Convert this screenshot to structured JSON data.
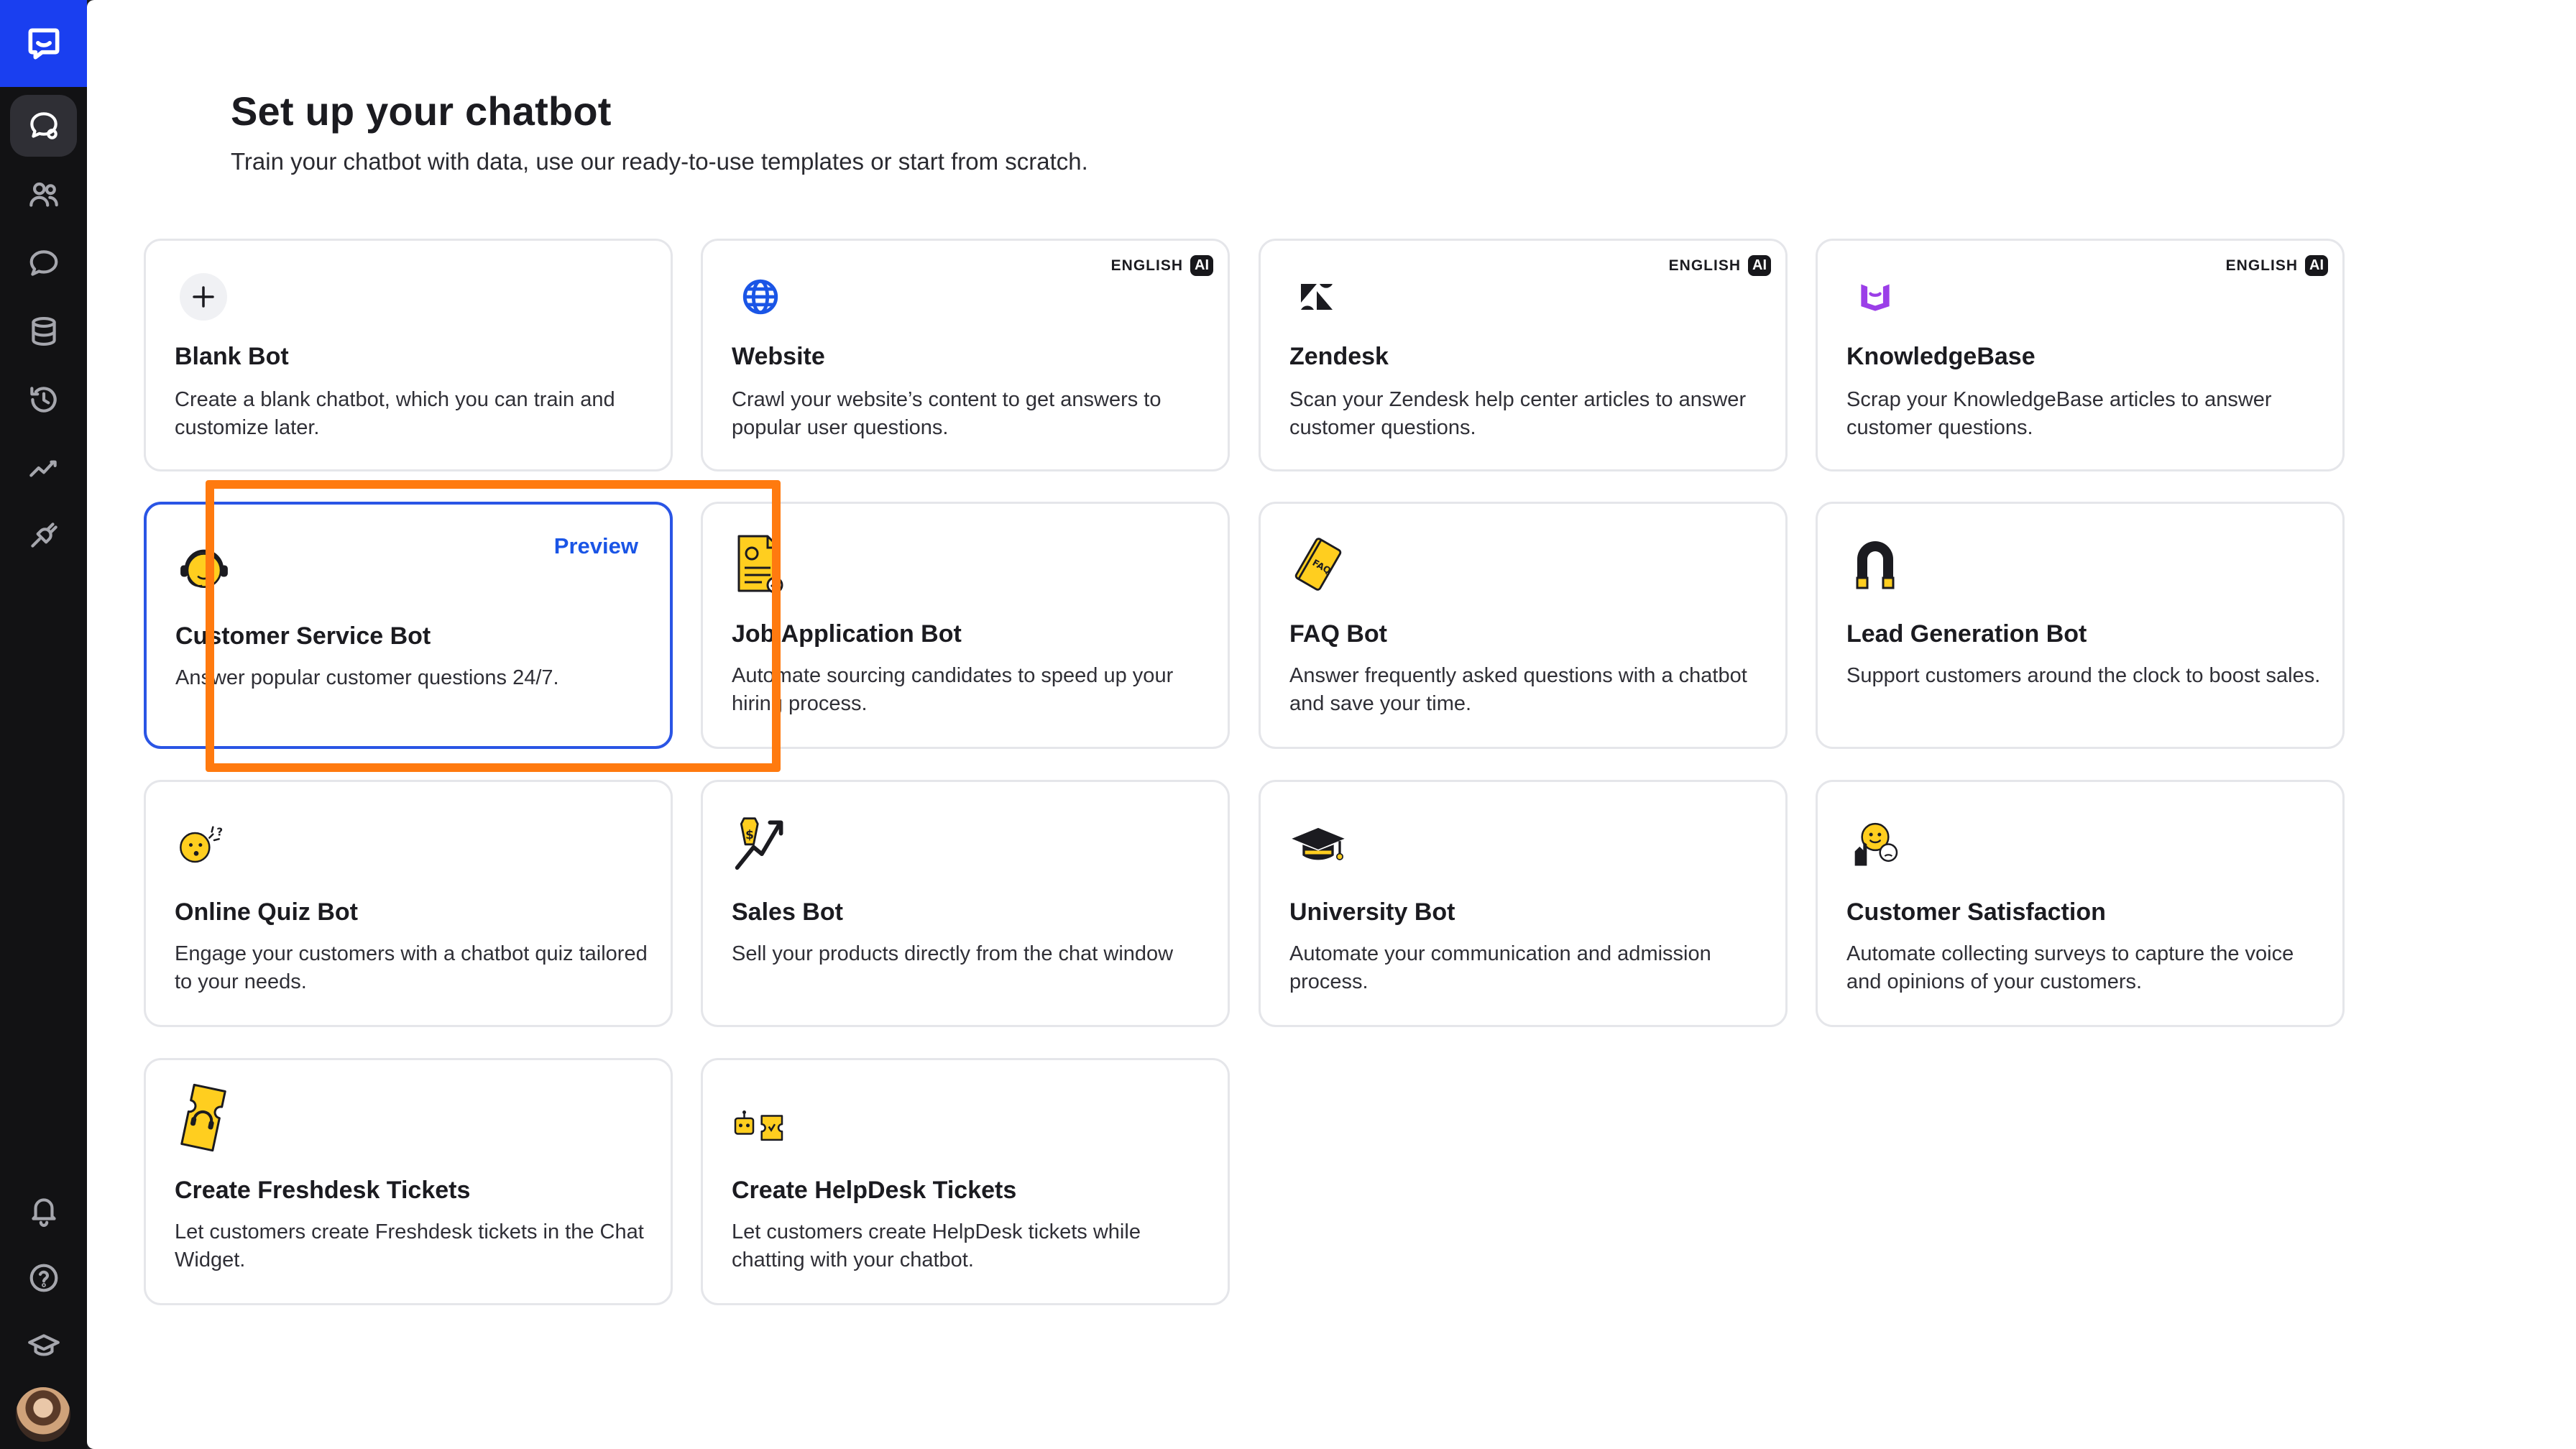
{
  "header": {
    "title": "Set up your chatbot",
    "subtitle": "Train your chatbot with data, use our ready-to-use templates or start from scratch."
  },
  "sidebar": {
    "items": [
      {
        "name": "chatbots",
        "icon": "chat-bot-icon",
        "active": true
      },
      {
        "name": "audience",
        "icon": "users-icon"
      },
      {
        "name": "chats",
        "icon": "chat-bubble-icon"
      },
      {
        "name": "data",
        "icon": "database-icon"
      },
      {
        "name": "history",
        "icon": "history-icon"
      },
      {
        "name": "reports",
        "icon": "chart-line-icon"
      },
      {
        "name": "integrations",
        "icon": "plug-icon"
      },
      {
        "name": "notifications",
        "icon": "bell-icon"
      },
      {
        "name": "help",
        "icon": "help-circle-icon"
      },
      {
        "name": "academy",
        "icon": "graduation-cap-icon"
      }
    ]
  },
  "badge": {
    "lang": "ENGLISH",
    "ai": "AI"
  },
  "cards": {
    "blank": {
      "title": "Blank Bot",
      "desc": "Create a blank chatbot, which you can train and customize later."
    },
    "website": {
      "title": "Website",
      "desc": "Crawl your website’s content to get answers to popular user questions."
    },
    "zendesk": {
      "title": "Zendesk",
      "desc": "Scan your Zendesk help center articles to answer customer questions."
    },
    "knowledgebase": {
      "title": "KnowledgeBase",
      "desc": "Scrap your KnowledgeBase articles to answer customer questions."
    },
    "customer_service": {
      "title": "Customer Service Bot",
      "desc": "Answer popular customer questions 24/7.",
      "preview": "Preview"
    },
    "job_application": {
      "title": "Job Application Bot",
      "desc": "Automate sourcing candidates to speed up your hiring process."
    },
    "faq": {
      "title": "FAQ Bot",
      "desc": "Answer frequently asked questions with a chatbot and save your time."
    },
    "lead_generation": {
      "title": "Lead Generation Bot",
      "desc": "Support customers around the clock to boost sales."
    },
    "online_quiz": {
      "title": "Online Quiz Bot",
      "desc": "Engage your customers with a chatbot quiz tailored to your needs."
    },
    "sales": {
      "title": "Sales Bot",
      "desc": "Sell your products directly from the chat window"
    },
    "university": {
      "title": "University Bot",
      "desc": "Automate your communication and admission process."
    },
    "customer_satisfaction": {
      "title": "Customer Satisfaction",
      "desc": "Automate collecting surveys to capture the voice and opinions of your customers."
    },
    "freshdesk": {
      "title": "Create Freshdesk Tickets",
      "desc": "Let customers create Freshdesk tickets in the Chat Widget."
    },
    "helpdesk": {
      "title": "Create HelpDesk Tickets",
      "desc": "Let customers create HelpDesk tickets while chatting with your chatbot."
    }
  },
  "colors": {
    "accent": "#2a55e5",
    "highlight": "#ff7a0f",
    "sidebar": "#121214",
    "logo": "#1a3ff0",
    "icon_yellow": "#ffce1f"
  }
}
